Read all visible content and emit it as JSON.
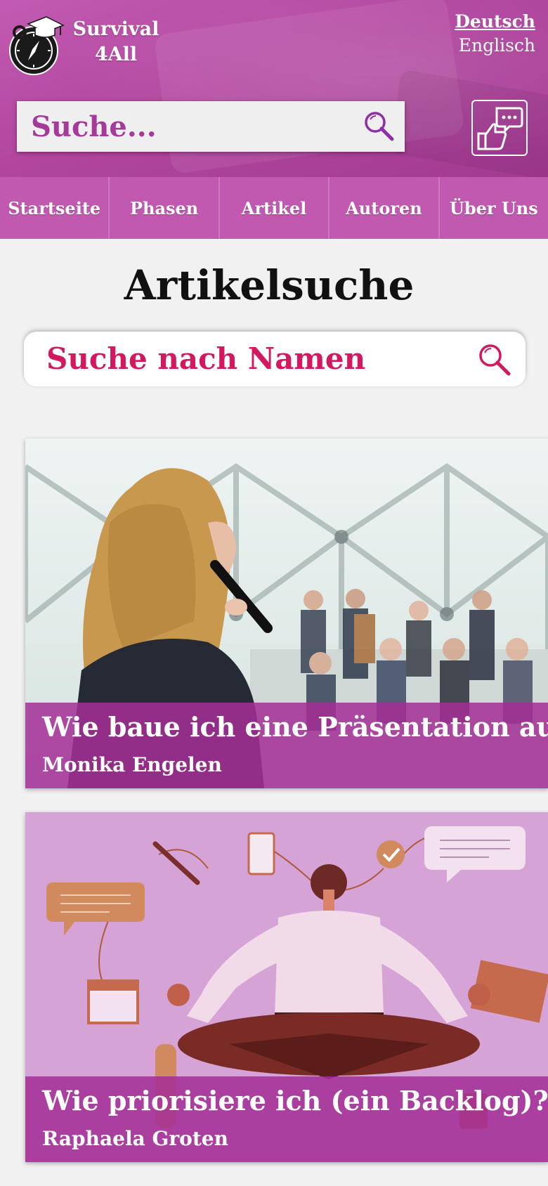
{
  "brand": {
    "line1": "Survival",
    "line2": "4All"
  },
  "language": {
    "active": "Deutsch",
    "other": "Englisch"
  },
  "top_search": {
    "placeholder": "Suche..."
  },
  "nav": {
    "items": [
      "Startseite",
      "Phasen",
      "Artikel",
      "Autoren",
      "Über Uns"
    ]
  },
  "page": {
    "title": "Artikelsuche"
  },
  "name_search": {
    "placeholder": "Suche nach Namen"
  },
  "articles": [
    {
      "title": "Wie baue ich eine Präsentation auf?",
      "author": "Monika Engelen"
    },
    {
      "title": "Wie priorisiere ich (ein Backlog)?",
      "author": "Raphaela Groten"
    }
  ],
  "colors": {
    "header": "#b2469f",
    "nav": "#c159b0",
    "accent": "#d4185f",
    "caption": "#a42e96"
  },
  "icons": {
    "logo": "compass-graduation-cap-icon",
    "search": "magnifier-icon",
    "feedback": "thumbs-up-chat-icon"
  }
}
